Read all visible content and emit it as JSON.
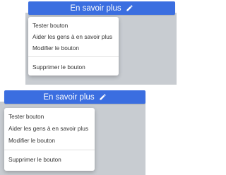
{
  "colors": {
    "button_blue": "#3b6ee0",
    "backdrop_gray": "#c8ccd1",
    "menu_text": "#333333"
  },
  "panels": [
    {
      "button_label": "En savoir plus",
      "button_icon": "pencil-icon",
      "menu": {
        "items": [
          "Tester bouton",
          "Aider les gens à en savoir plus",
          "Modifier le bouton"
        ],
        "danger_item": "Supprimer le bouton"
      }
    },
    {
      "button_label": "En savoir plus",
      "button_icon": "pencil-icon",
      "menu": {
        "items": [
          "Tester bouton",
          "Aider les gens à en savoir plus",
          "Modifier le bouton"
        ],
        "danger_item": "Supprimer le bouton"
      }
    }
  ]
}
